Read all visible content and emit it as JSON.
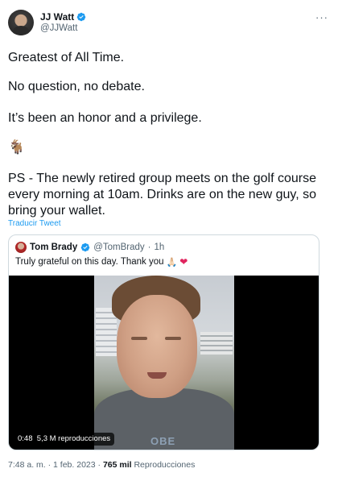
{
  "author": {
    "display_name": "JJ Watt",
    "handle": "@JJWatt",
    "verified": true,
    "avatar_icon": "profile-photo"
  },
  "more_icon": "···",
  "tweet": {
    "paragraphs": [
      "Greatest of All Time.",
      "No question, no debate.",
      "It’s been an honor and a privilege.",
      "🐐",
      "PS - The newly retired group meets on the golf course every morning at 10am. Drinks are on the new guy, so bring your wallet."
    ],
    "translate_label": "Traducir Tweet"
  },
  "quoted": {
    "display_name": "Tom Brady",
    "handle": "@TomBrady",
    "separator": "·",
    "time": "1h",
    "text": "Truly grateful on this day. Thank you",
    "emoji_hands": "🙏🏻",
    "emoji_heart": "❤",
    "video": {
      "duration": "0:48",
      "views": "5,3 M reproducciones",
      "shirt_text": "OBE"
    }
  },
  "meta": {
    "time": "7:48 a. m.",
    "dot": "·",
    "date": "1 feb. 2023",
    "views_count": "765 mil",
    "views_label": "Reproducciones"
  },
  "colors": {
    "accent": "#1d9bf0",
    "text": "#0f1419",
    "secondary": "#536471",
    "border": "#cfd9de",
    "heart": "#e0245e"
  }
}
